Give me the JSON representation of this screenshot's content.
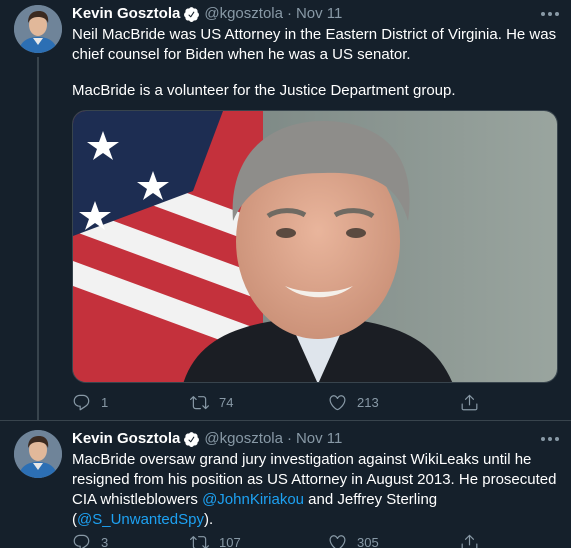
{
  "tweets": [
    {
      "author": {
        "name": "Kevin Gosztola",
        "handle": "@kgosztola",
        "time": "Nov 11",
        "verified": true
      },
      "text_p1": "Neil MacBride was US Attorney in the Eastern District of Virginia. He was chief counsel for Biden when he was a US senator.",
      "text_p2": "MacBride is a volunteer for the Justice Department group.",
      "counts": {
        "replies": "1",
        "retweets": "74",
        "likes": "213"
      },
      "has_media": true
    },
    {
      "author": {
        "name": "Kevin Gosztola",
        "handle": "@kgosztola",
        "time": "Nov 11",
        "verified": true
      },
      "text_parts": [
        "MacBride oversaw grand jury investigation against WikiLeaks until he resigned from his position as US Attorney in August 2013. He prosecuted CIA whistleblowers ",
        "@JohnKiriakou",
        " and Jeffrey Sterling (",
        "@S_UnwantedSpy",
        ")."
      ],
      "counts": {
        "replies": "3",
        "retweets": "107",
        "likes": "305"
      }
    }
  ],
  "ui": {
    "separator": "·",
    "colors": {
      "background": "#15202b",
      "secondary_text": "#8899a6",
      "link": "#1da1f2",
      "divider": "#38444d"
    },
    "icons": [
      "verified-badge-icon",
      "more-options-icon",
      "reply-icon",
      "retweet-icon",
      "like-icon",
      "share-icon"
    ]
  }
}
